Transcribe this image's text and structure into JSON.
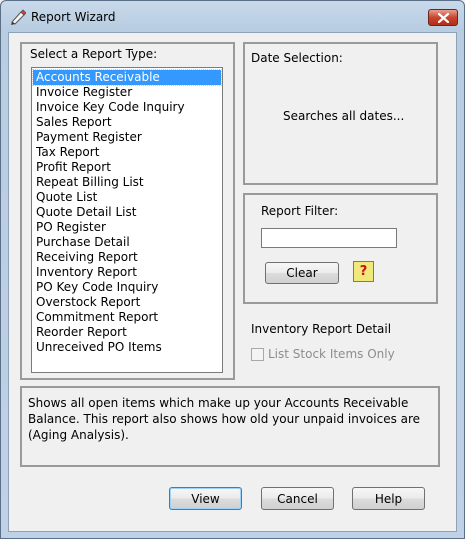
{
  "window": {
    "title": "Report Wizard",
    "close_label": "✕"
  },
  "report_type": {
    "label": "Select a Report Type:",
    "items": [
      "Accounts Receivable",
      "Invoice Register",
      "Invoice Key Code Inquiry",
      "Sales Report",
      "Payment Register",
      "Tax Report",
      "Profit Report",
      "Repeat Billing List",
      "Quote List",
      "Quote Detail List",
      "PO Register",
      "Purchase Detail",
      "Receiving Report",
      "Inventory Report",
      "PO Key Code Inquiry",
      "Overstock Report",
      "Commitment Report",
      "Reorder Report",
      "Unreceived PO Items"
    ],
    "selected_index": 0
  },
  "date_selection": {
    "label": "Date Selection:",
    "text": "Searches all dates..."
  },
  "report_filter": {
    "label": "Report Filter:",
    "value": "",
    "clear_label": "Clear",
    "help_glyph": "?"
  },
  "inventory": {
    "heading": "Inventory Report Detail",
    "checkbox_label": "List Stock Items Only",
    "checked": false
  },
  "description": {
    "text": "Shows all open items which make up your Accounts Receivable Balance. This report also shows how old your unpaid invoices are (Aging Analysis)."
  },
  "buttons": {
    "view": "View",
    "cancel": "Cancel",
    "help": "Help"
  },
  "colors": {
    "selection": "#3399ff",
    "help_icon_bg": "#f0e87a",
    "close_button": "#c8452f"
  }
}
